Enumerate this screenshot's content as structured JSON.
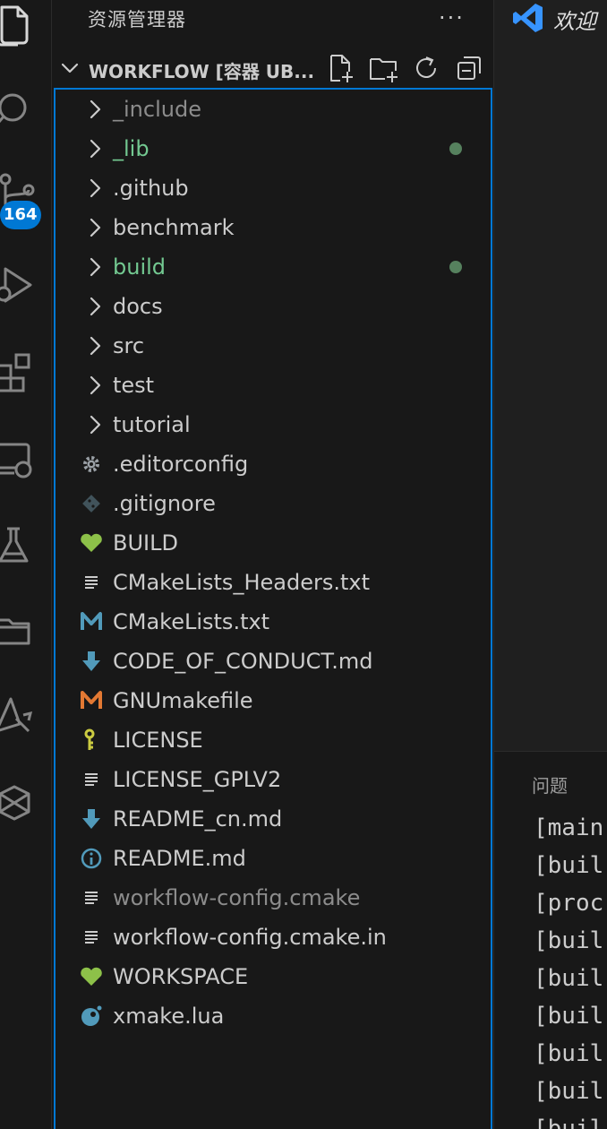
{
  "sidebar": {
    "title": "资源管理器",
    "more_actions": "···",
    "workspace_title": "WORKFLOW [容器 UB..."
  },
  "activity_bar": {
    "source_control_badge": "164"
  },
  "tree": {
    "items": [
      {
        "label": "_include",
        "type": "folder",
        "icon": "chevron-right-icon",
        "color": "#8c8c8c",
        "dot": false
      },
      {
        "label": "_lib",
        "type": "folder",
        "icon": "chevron-right-icon",
        "color": "#73c991",
        "dot": true
      },
      {
        "label": ".github",
        "type": "folder",
        "icon": "chevron-right-icon",
        "color": "#cccccc",
        "dot": false
      },
      {
        "label": "benchmark",
        "type": "folder",
        "icon": "chevron-right-icon",
        "color": "#cccccc",
        "dot": false
      },
      {
        "label": "build",
        "type": "folder",
        "icon": "chevron-right-icon",
        "color": "#73c991",
        "dot": true
      },
      {
        "label": "docs",
        "type": "folder",
        "icon": "chevron-right-icon",
        "color": "#cccccc",
        "dot": false
      },
      {
        "label": "src",
        "type": "folder",
        "icon": "chevron-right-icon",
        "color": "#cccccc",
        "dot": false
      },
      {
        "label": "test",
        "type": "folder",
        "icon": "chevron-right-icon",
        "color": "#cccccc",
        "dot": false
      },
      {
        "label": "tutorial",
        "type": "folder",
        "icon": "chevron-right-icon",
        "color": "#cccccc",
        "dot": false
      },
      {
        "label": ".editorconfig",
        "type": "file",
        "icon": "gear-icon",
        "color": "#cccccc",
        "dot": false
      },
      {
        "label": ".gitignore",
        "type": "file",
        "icon": "git-icon",
        "color": "#cccccc",
        "dot": false
      },
      {
        "label": "BUILD",
        "type": "file",
        "icon": "bazel-heart-icon",
        "color": "#cccccc",
        "dot": false
      },
      {
        "label": "CMakeLists_Headers.txt",
        "type": "file",
        "icon": "text-lines-icon",
        "color": "#cccccc",
        "dot": false
      },
      {
        "label": "CMakeLists.txt",
        "type": "file",
        "icon": "m-blue-icon",
        "color": "#cccccc",
        "dot": false
      },
      {
        "label": "CODE_OF_CONDUCT.md",
        "type": "file",
        "icon": "markdown-arrow-icon",
        "color": "#cccccc",
        "dot": false
      },
      {
        "label": "GNUmakefile",
        "type": "file",
        "icon": "m-orange-icon",
        "color": "#cccccc",
        "dot": false
      },
      {
        "label": "LICENSE",
        "type": "file",
        "icon": "license-key-icon",
        "color": "#cccccc",
        "dot": false
      },
      {
        "label": "LICENSE_GPLV2",
        "type": "file",
        "icon": "text-lines-icon",
        "color": "#cccccc",
        "dot": false
      },
      {
        "label": "README_cn.md",
        "type": "file",
        "icon": "markdown-arrow-icon",
        "color": "#cccccc",
        "dot": false
      },
      {
        "label": "README.md",
        "type": "file",
        "icon": "info-icon",
        "color": "#cccccc",
        "dot": false
      },
      {
        "label": "workflow-config.cmake",
        "type": "file",
        "icon": "text-lines-icon",
        "color": "#8c8c8c",
        "dot": false
      },
      {
        "label": "workflow-config.cmake.in",
        "type": "file",
        "icon": "text-lines-icon",
        "color": "#cccccc",
        "dot": false
      },
      {
        "label": "WORKSPACE",
        "type": "file",
        "icon": "bazel-heart-icon",
        "color": "#cccccc",
        "dot": false
      },
      {
        "label": "xmake.lua",
        "type": "file",
        "icon": "lua-icon",
        "color": "#cccccc",
        "dot": false
      }
    ]
  },
  "editor": {
    "tab_title": "欢迎"
  },
  "panel": {
    "tab_label": "问题",
    "terminal_lines": [
      "[main",
      "[buil",
      "[proc",
      "[buil",
      "[buil",
      "[buil",
      "[buil",
      "[buil",
      "[buil"
    ]
  },
  "colors": {
    "accent": "#0078d4",
    "modified_green": "#73c991",
    "dot_green": "#56815e"
  }
}
